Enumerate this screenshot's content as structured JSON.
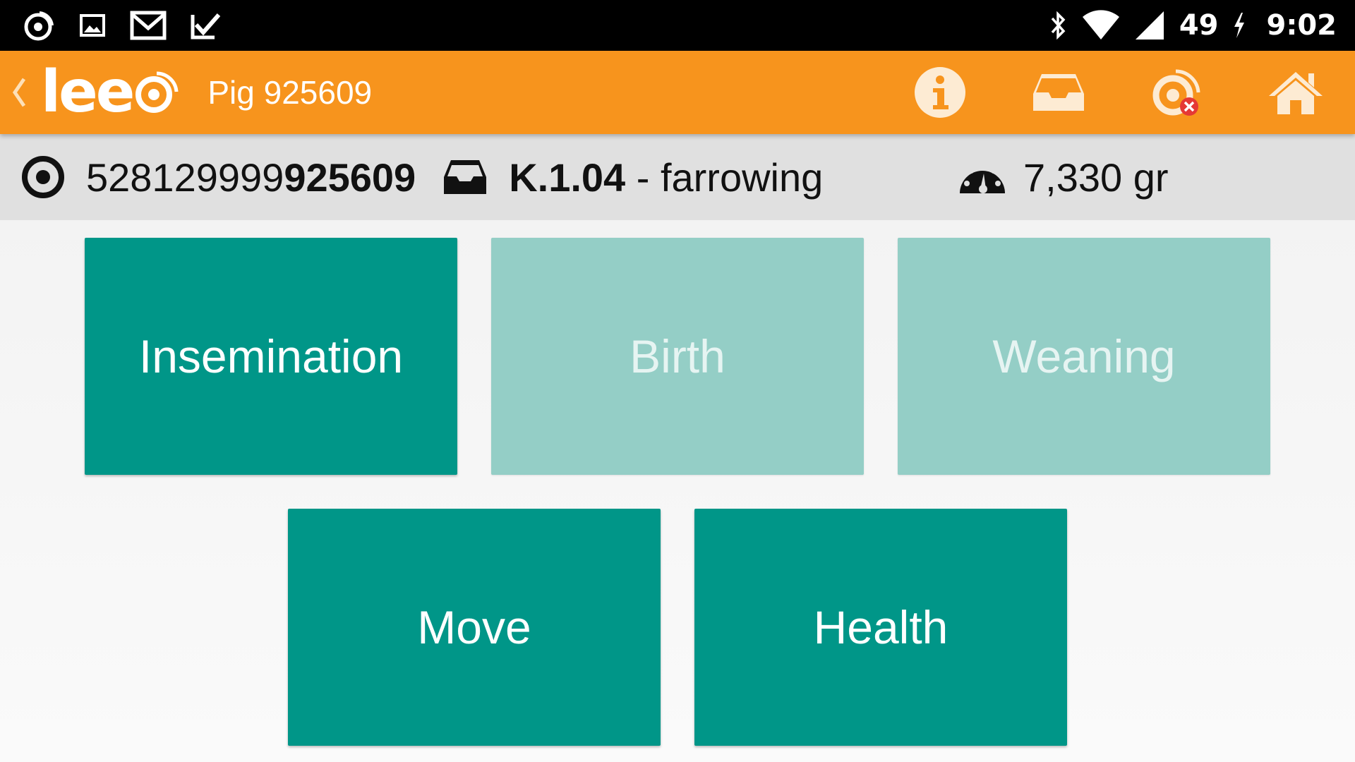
{
  "status_bar": {
    "battery": "49",
    "time": "9:02"
  },
  "app_bar": {
    "logo": "lee",
    "title": "Pig 925609",
    "actions": [
      {
        "icon": "info-icon"
      },
      {
        "icon": "inbox-icon"
      },
      {
        "icon": "rfid-disconnected-icon"
      },
      {
        "icon": "home-icon"
      }
    ]
  },
  "info": {
    "tag_prefix": "528129999",
    "tag_suffix": "925609",
    "pen_code": "K.1.04",
    "pen_desc": " - farrowing",
    "weight": "7,330 gr"
  },
  "tiles": [
    {
      "label": "Insemination",
      "enabled": true
    },
    {
      "label": "Birth",
      "enabled": false
    },
    {
      "label": "Weaning",
      "enabled": false
    },
    {
      "label": "Move",
      "enabled": true
    },
    {
      "label": "Health",
      "enabled": true
    }
  ],
  "colors": {
    "status_bar": "#000000",
    "app_bar": "#f7941d",
    "tile_active": "#009688",
    "tile_disabled": "#94cec6",
    "info_strip": "#e0e0e0"
  }
}
